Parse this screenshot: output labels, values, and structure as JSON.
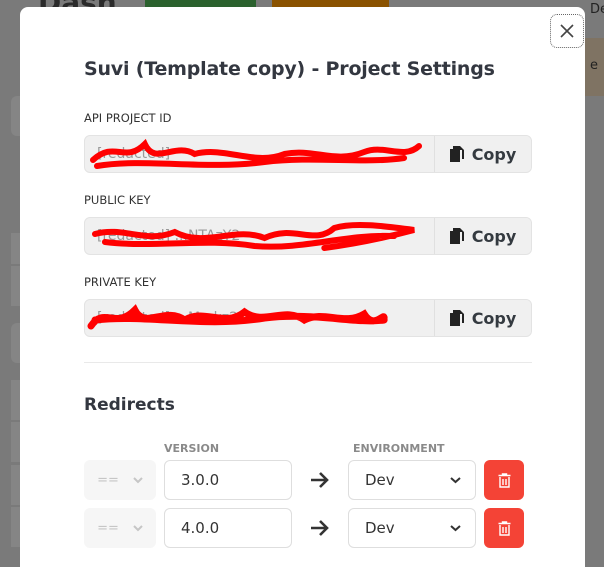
{
  "background": {
    "page_title_fragment": "Dash",
    "right_text_1": "De",
    "right_text_2": "e"
  },
  "modal": {
    "title": "Suvi (Template copy) - Project Settings",
    "close_icon": "close-icon",
    "keys": [
      {
        "label": "API PROJECT ID",
        "value": "[redacted]",
        "copy_label": "Copy",
        "redacted": true
      },
      {
        "label": "PUBLIC KEY",
        "value": "[redacted] ...NTAzY2",
        "copy_label": "Copy",
        "redacted": true
      },
      {
        "label": "PRIVATE KEY",
        "value": "[redacted] ...Mmkz2",
        "copy_label": "Copy",
        "redacted": true
      }
    ],
    "copy_icon": "copy-icon",
    "redaction_color": "#ff0000",
    "redirects": {
      "title": "Redirects",
      "columns": {
        "version": "VERSION",
        "environment": "ENVIRONMENT"
      },
      "rows": [
        {
          "operator": "==",
          "version": "3.0.0",
          "environment": "Dev"
        },
        {
          "operator": "==",
          "version": "4.0.0",
          "environment": "Dev"
        }
      ],
      "delete_color": "#f44336"
    }
  }
}
